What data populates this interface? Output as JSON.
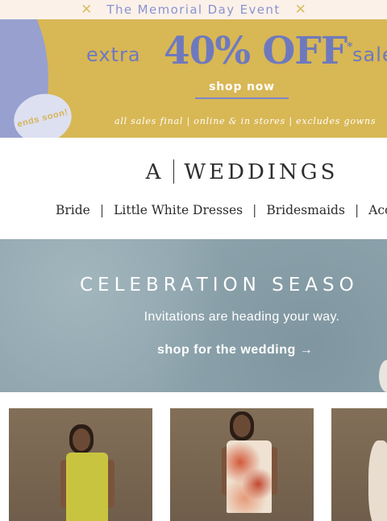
{
  "announcement": {
    "title": "The Memorial Day Event",
    "icon": "x-icon"
  },
  "promo": {
    "extra": "extra",
    "headline": "40% OFF",
    "trademark": "*",
    "tail": "sale",
    "cta": "shop now",
    "fine_print": "all sales final  |  online & in stores  |  excludes gowns",
    "badge": "ends soon!",
    "colors": {
      "background": "#d8b755",
      "text": "#6e79bd",
      "badge": "#dde0f1"
    }
  },
  "brand": {
    "left": "A",
    "right": "WEDDINGS"
  },
  "nav": {
    "items": [
      "Bride",
      "Little White Dresses",
      "Bridesmaids",
      "Acces"
    ]
  },
  "hero": {
    "title": "CELEBRATION SEASO",
    "subtitle": "Invitations are heading your way.",
    "cta": "shop for the wedding →"
  },
  "products": [
    {
      "name": "yellow-dress",
      "color": "#c9c43f"
    },
    {
      "name": "floral-dress",
      "color": "#efe2d2"
    },
    {
      "name": "partial-product",
      "color": "#e9e4dd"
    }
  ]
}
